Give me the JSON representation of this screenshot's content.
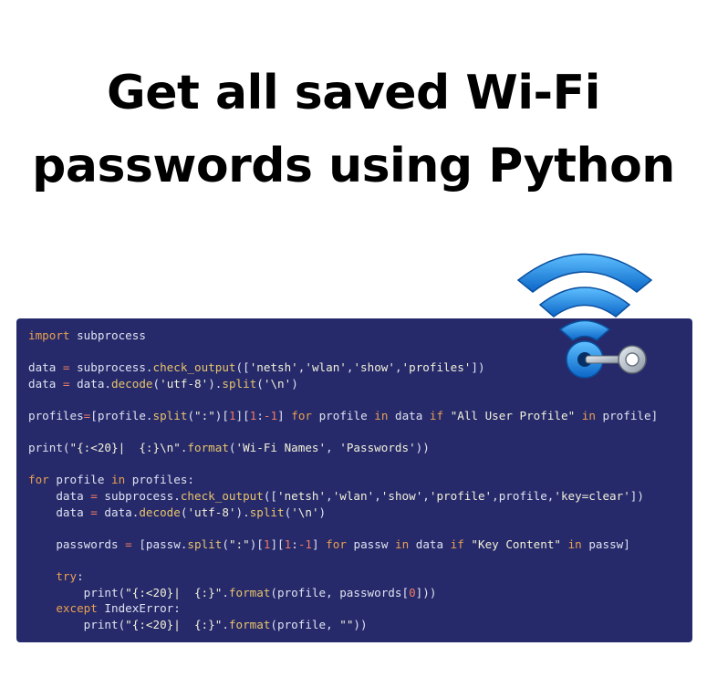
{
  "title": {
    "line1": "Get all saved Wi-Fi",
    "line2": "passwords using Python"
  },
  "code": {
    "lines": [
      [
        {
          "t": "import",
          "c": "kw"
        },
        {
          "t": " subprocess"
        }
      ],
      [],
      [
        {
          "t": "data "
        },
        {
          "t": "=",
          "c": "op"
        },
        {
          "t": " subprocess."
        },
        {
          "t": "check_output",
          "c": "fn"
        },
        {
          "t": "(["
        },
        {
          "t": "'netsh'",
          "c": "str"
        },
        {
          "t": ","
        },
        {
          "t": "'wlan'",
          "c": "str"
        },
        {
          "t": ","
        },
        {
          "t": "'show'",
          "c": "str"
        },
        {
          "t": ","
        },
        {
          "t": "'profiles'",
          "c": "str"
        },
        {
          "t": "])"
        }
      ],
      [
        {
          "t": "data "
        },
        {
          "t": "=",
          "c": "op"
        },
        {
          "t": " data."
        },
        {
          "t": "decode",
          "c": "fn"
        },
        {
          "t": "("
        },
        {
          "t": "'utf-8'",
          "c": "str"
        },
        {
          "t": ")."
        },
        {
          "t": "split",
          "c": "fn"
        },
        {
          "t": "("
        },
        {
          "t": "'\\n'",
          "c": "str"
        },
        {
          "t": ")"
        }
      ],
      [],
      [
        {
          "t": "profiles"
        },
        {
          "t": "=",
          "c": "op"
        },
        {
          "t": "[profile."
        },
        {
          "t": "split",
          "c": "fn"
        },
        {
          "t": "("
        },
        {
          "t": "\":\"",
          "c": "str"
        },
        {
          "t": ")["
        },
        {
          "t": "1",
          "c": "num"
        },
        {
          "t": "]["
        },
        {
          "t": "1",
          "c": "num"
        },
        {
          "t": ":"
        },
        {
          "t": "-1",
          "c": "num"
        },
        {
          "t": "] "
        },
        {
          "t": "for",
          "c": "kw"
        },
        {
          "t": " profile "
        },
        {
          "t": "in",
          "c": "kw"
        },
        {
          "t": " data "
        },
        {
          "t": "if",
          "c": "kw"
        },
        {
          "t": " "
        },
        {
          "t": "\"All User Profile\"",
          "c": "str"
        },
        {
          "t": " "
        },
        {
          "t": "in",
          "c": "kw"
        },
        {
          "t": " profile]"
        }
      ],
      [],
      [
        {
          "t": "print("
        },
        {
          "t": "\"{:<20}|  {:}\\n\"",
          "c": "str"
        },
        {
          "t": "."
        },
        {
          "t": "format",
          "c": "fn"
        },
        {
          "t": "("
        },
        {
          "t": "'Wi-Fi Names'",
          "c": "str"
        },
        {
          "t": ", "
        },
        {
          "t": "'Passwords'",
          "c": "str"
        },
        {
          "t": "))"
        }
      ],
      [],
      [
        {
          "t": "for",
          "c": "kw"
        },
        {
          "t": " profile "
        },
        {
          "t": "in",
          "c": "kw"
        },
        {
          "t": " profiles:"
        }
      ],
      [
        {
          "t": "    data "
        },
        {
          "t": "=",
          "c": "op"
        },
        {
          "t": " subprocess."
        },
        {
          "t": "check_output",
          "c": "fn"
        },
        {
          "t": "(["
        },
        {
          "t": "'netsh'",
          "c": "str"
        },
        {
          "t": ","
        },
        {
          "t": "'wlan'",
          "c": "str"
        },
        {
          "t": ","
        },
        {
          "t": "'show'",
          "c": "str"
        },
        {
          "t": ","
        },
        {
          "t": "'profile'",
          "c": "str"
        },
        {
          "t": ",profile,"
        },
        {
          "t": "'key=clear'",
          "c": "str"
        },
        {
          "t": "])"
        }
      ],
      [
        {
          "t": "    data "
        },
        {
          "t": "=",
          "c": "op"
        },
        {
          "t": " data."
        },
        {
          "t": "decode",
          "c": "fn"
        },
        {
          "t": "("
        },
        {
          "t": "'utf-8'",
          "c": "str"
        },
        {
          "t": ")."
        },
        {
          "t": "split",
          "c": "fn"
        },
        {
          "t": "("
        },
        {
          "t": "'\\n'",
          "c": "str"
        },
        {
          "t": ")"
        }
      ],
      [],
      [
        {
          "t": "    passwords "
        },
        {
          "t": "=",
          "c": "op"
        },
        {
          "t": " [passw."
        },
        {
          "t": "split",
          "c": "fn"
        },
        {
          "t": "("
        },
        {
          "t": "\":\"",
          "c": "str"
        },
        {
          "t": ")["
        },
        {
          "t": "1",
          "c": "num"
        },
        {
          "t": "]["
        },
        {
          "t": "1",
          "c": "num"
        },
        {
          "t": ":"
        },
        {
          "t": "-1",
          "c": "num"
        },
        {
          "t": "] "
        },
        {
          "t": "for",
          "c": "kw"
        },
        {
          "t": " passw "
        },
        {
          "t": "in",
          "c": "kw"
        },
        {
          "t": " data "
        },
        {
          "t": "if",
          "c": "kw"
        },
        {
          "t": " "
        },
        {
          "t": "\"Key Content\"",
          "c": "str"
        },
        {
          "t": " "
        },
        {
          "t": "in",
          "c": "kw"
        },
        {
          "t": " passw]"
        }
      ],
      [],
      [
        {
          "t": "    "
        },
        {
          "t": "try",
          "c": "kw"
        },
        {
          "t": ":"
        }
      ],
      [
        {
          "t": "        print("
        },
        {
          "t": "\"{:<20}|  {:}\"",
          "c": "str"
        },
        {
          "t": "."
        },
        {
          "t": "format",
          "c": "fn"
        },
        {
          "t": "(profile, passwords["
        },
        {
          "t": "0",
          "c": "num"
        },
        {
          "t": "]))"
        }
      ],
      [
        {
          "t": "    "
        },
        {
          "t": "except",
          "c": "kw"
        },
        {
          "t": " IndexError:"
        }
      ],
      [
        {
          "t": "        print("
        },
        {
          "t": "\"{:<20}|  {:}\"",
          "c": "str"
        },
        {
          "t": "."
        },
        {
          "t": "format",
          "c": "fn"
        },
        {
          "t": "(profile, "
        },
        {
          "t": "\"\"",
          "c": "str"
        },
        {
          "t": "))"
        }
      ]
    ]
  },
  "colors": {
    "card_background": "#262a6b",
    "keyword": "#e9a050",
    "function": "#e9c46a",
    "number": "#f07a62",
    "wifi_blue": "#1e90e8"
  },
  "icons": {
    "wifi": "wifi-key-icon"
  }
}
